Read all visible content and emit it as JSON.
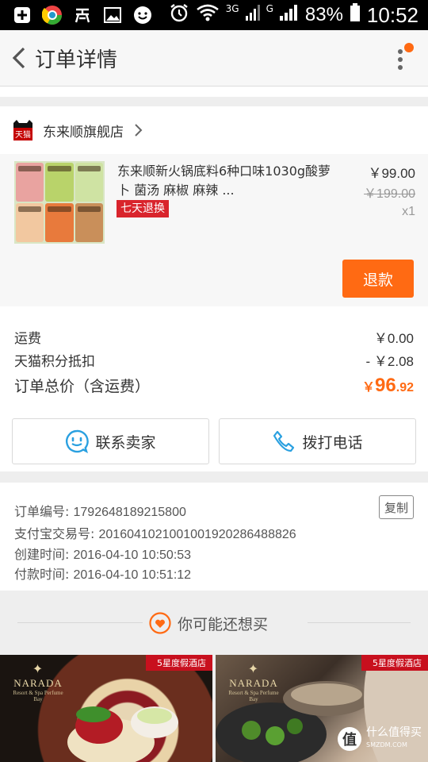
{
  "status_bar": {
    "icons": [
      "add-box-icon",
      "chrome-icon",
      "wallet-icon",
      "image-icon",
      "chat-bubble-icon",
      "alarm-icon",
      "wifi-icon",
      "signal-3g-icon",
      "signal-icon",
      "battery-icon"
    ],
    "net_3g": "3G",
    "net_g": "G",
    "battery": "83%",
    "time": "10:52"
  },
  "header": {
    "title": "订单详情"
  },
  "store": {
    "name": "东来顺旗舰店",
    "logo_text": "天猫"
  },
  "product": {
    "name": "东来顺新火锅底料6种口味1030g酸萝卜 菌汤 麻椒 麻辣 ...",
    "tag": "七天退换",
    "price": "￥99.00",
    "original_price": "￥199.00",
    "quantity": "x1",
    "refund_label": "退款"
  },
  "totals": {
    "shipping_label": "运费",
    "shipping_value": "￥0.00",
    "points_label": "天猫积分抵扣",
    "points_value": "- ￥2.08",
    "total_label": "订单总价（含运费）",
    "total_currency": "￥",
    "total_int": "96",
    "total_dec": ".92"
  },
  "actions": {
    "contact_seller": "联系卖家",
    "call_phone": "拨打电话"
  },
  "order_info": {
    "order_no_label": "订单编号:",
    "order_no": "1792648189215800",
    "alipay_label": "支付宝交易号:",
    "alipay_no": "2016041021001001920286488826",
    "created_label": "创建时间:",
    "created": "2016-04-10 10:50:53",
    "paid_label": "付款时间:",
    "paid": "2016-04-10 10:51:12",
    "copy_label": "复制"
  },
  "recommend": {
    "title": "你可能还想买",
    "cards": [
      {
        "badge": "5星度假酒店",
        "brand": "NARADA",
        "brand_sub": "Resort & Spa Perfume Bay"
      },
      {
        "badge": "5星度假酒店",
        "brand": "NARADA",
        "brand_sub": "Resort & Spa Perfume Bay"
      }
    ],
    "watermark_glyph": "值",
    "watermark_text": "什么值得买",
    "watermark_sub": "SMZDM.COM"
  },
  "colors": {
    "accent": "#ff6a13",
    "tag_red": "#d9242c",
    "icon_blue": "#2aa0e0"
  }
}
